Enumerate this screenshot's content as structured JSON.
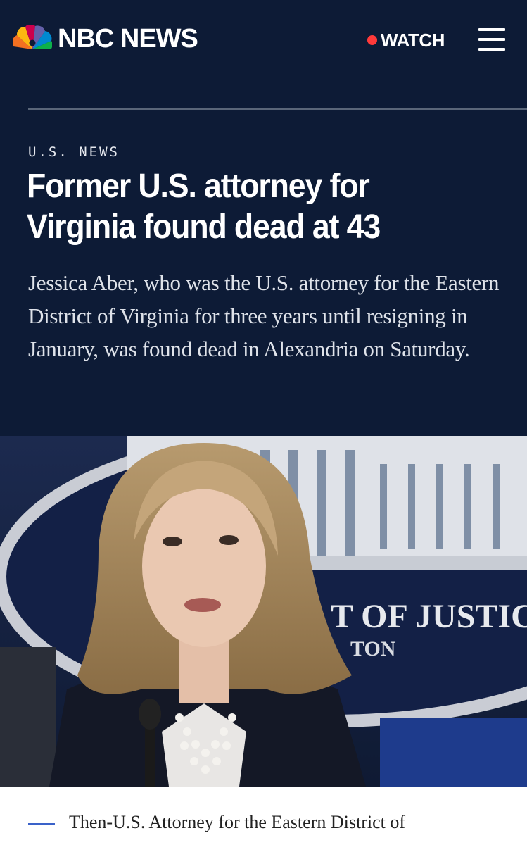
{
  "header": {
    "brand": "NBC NEWS",
    "logo_icon": "nbc-peacock-icon",
    "watch_label": "WATCH",
    "menu_icon": "hamburger-menu-icon"
  },
  "article": {
    "kicker": "U.S. NEWS",
    "headline": "Former U.S. attorney for Virginia found dead at 43",
    "dek": "Jessica Aber, who was the U.S. attorney for the Eastern District of Virginia for three years until resigning in January, was found dead in Alexandria on Saturday.",
    "photo_sign_text_1": "T OF JUSTIC",
    "photo_sign_text_2": "TON",
    "caption": "Then-U.S. Attorney for the Eastern District of"
  },
  "colors": {
    "background": "#0d1b36",
    "watch_dot": "#ff3a3a",
    "caption_rule": "#3a62c9"
  }
}
